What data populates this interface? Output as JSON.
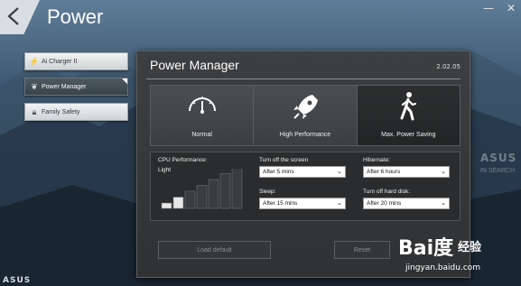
{
  "header": {
    "title": "Power",
    "controls": [
      "—",
      "✕"
    ]
  },
  "sidebar": {
    "items": [
      {
        "label": "Ai Charger II",
        "icon": "lightning-icon"
      },
      {
        "label": "Power Manager",
        "icon": "leaf-icon"
      },
      {
        "label": "Family Safety",
        "icon": "lock-icon"
      }
    ],
    "active_index": 1
  },
  "panel": {
    "title": "Power Manager",
    "version": "2.02.05",
    "modes": [
      {
        "label": "Normal",
        "icon": "speedometer-icon"
      },
      {
        "label": "High Performance",
        "icon": "rocket-icon"
      },
      {
        "label": "Max. Power Saving",
        "icon": "walking-person-icon"
      }
    ],
    "selected_mode": "Max. Power Saving",
    "cpu_performance": {
      "label": "CPU Performance:",
      "value": "Light"
    },
    "turn_off_screen": {
      "label": "Turn off the screen",
      "value": "After 5 mins"
    },
    "sleep": {
      "label": "Sleep:",
      "value": "After 15 mins"
    },
    "hibernate": {
      "label": "Hibernate:",
      "value": "After 6 hours"
    },
    "turn_off_hdd": {
      "label": "Turn off hard disk:",
      "value": "After 20 mins"
    },
    "load_default_label": "Load default",
    "reset_label": "Reset"
  },
  "branding": {
    "side_text": "ASUS",
    "side_subtext": "IN SEARCH",
    "bottom_logo": "ASUS"
  },
  "watermark": {
    "brand": "Bai度",
    "text": "经验",
    "url": "jingyan.baidu.com"
  }
}
